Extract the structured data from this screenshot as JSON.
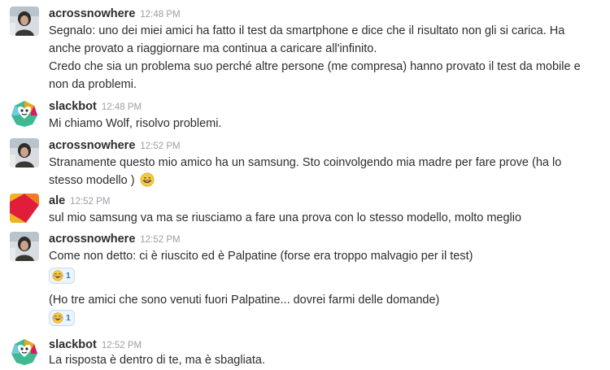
{
  "messages": [
    {
      "user": "acrossnowhere",
      "time": "12:48 PM",
      "lines": [
        "Segnalo: uno dei miei amici ha fatto il test da smartphone e dice che il risultato non gli si carica. Ha",
        "anche provato a riaggiornare ma continua a caricare all'infinito.",
        "Credo che sia un problema suo perché altre persone (me compresa) hanno provato il test da mobile e",
        "non da problemi."
      ]
    },
    {
      "user": "slackbot",
      "time": "12:48 PM",
      "lines": [
        "Mi chiamo Wolf, risolvo problemi."
      ]
    },
    {
      "user": "acrossnowhere",
      "time": "12:52 PM",
      "lines": [
        "Stranamente questo mio amico ha un samsung. Sto coinvolgendo mia madre per fare prove (ha lo",
        "stesso modello )"
      ],
      "emoji": "grinning-face-emoji"
    },
    {
      "user": "ale",
      "time": "12:52 PM",
      "lines": [
        "sul mio samsung va ma se riusciamo a fare una prova con lo stesso modello, molto meglio"
      ]
    },
    {
      "user": "acrossnowhere",
      "time": "12:52 PM",
      "lines": [
        "Come non detto: ci è riuscito ed è Palpatine (forse era troppo malvagio per il test)"
      ],
      "reaction": {
        "emoji": "joy-emoji",
        "count": "1"
      },
      "followup": {
        "lines": [
          "(Ho tre amici che sono venuti fuori Palpatine... dovrei farmi delle domande)"
        ],
        "reaction": {
          "emoji": "joy-emoji",
          "count": "1"
        }
      }
    },
    {
      "user": "slackbot",
      "time": "12:52 PM",
      "lines": [
        "La risposta è dentro di te, ma è sbagliata."
      ]
    }
  ],
  "colors": {
    "text": "#2c2d30",
    "timestamp": "#9e9ea6",
    "reaction_bg": "#edf4fc",
    "reaction_border": "#c9dbf0",
    "reaction_count": "#2a80b9"
  }
}
